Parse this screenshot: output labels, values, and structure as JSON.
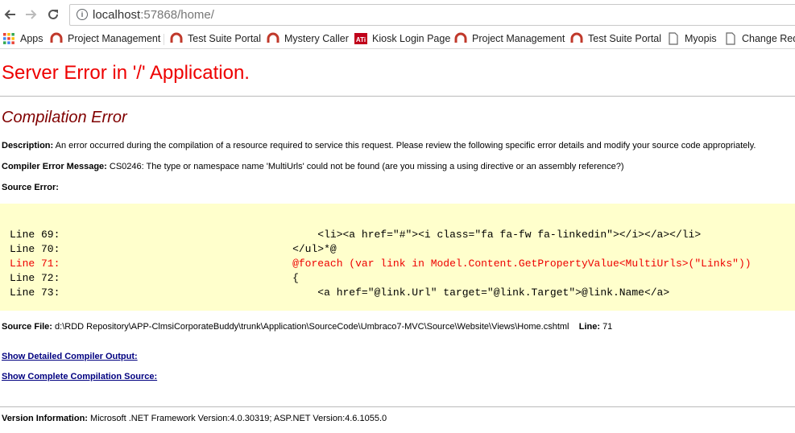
{
  "browser": {
    "url_host": "localhost",
    "url_rest": ":57868/home/"
  },
  "bookmarks": [
    {
      "label": "Apps",
      "icon": "apps-grid-icon"
    },
    {
      "label": "Project Management",
      "icon": "redirect-icon"
    },
    {
      "label": "Test Suite Portal",
      "icon": "redirect-icon"
    },
    {
      "label": "Mystery Caller",
      "icon": "redirect-icon"
    },
    {
      "label": "Kiosk Login Page",
      "icon": "ati-logo-icon"
    },
    {
      "label": "Project Management",
      "icon": "redirect-icon"
    },
    {
      "label": "Test Suite Portal",
      "icon": "redirect-icon"
    },
    {
      "label": "Myopis",
      "icon": "page-icon"
    },
    {
      "label": "Change Requ",
      "icon": "page-icon"
    }
  ],
  "error": {
    "title": "Server Error in '/' Application.",
    "subtitle": "Compilation Error",
    "description_label": "Description:",
    "description": "An error occurred during the compilation of a resource required to service this request. Please review the following specific error details and modify your source code appropriately.",
    "compiler_msg_label": "Compiler Error Message:",
    "compiler_msg": "CS0246: The type or namespace name 'MultiUrls' could not be found (are you missing a using directive or an assembly reference?)",
    "source_error_label": "Source Error:",
    "code_lines": [
      {
        "num": "Line 69:",
        "code": "                                        <li><a href=\"#\"><i class=\"fa fa-fw fa-linkedin\"></i></a></li>",
        "error": false
      },
      {
        "num": "Line 70:",
        "code": "                                    </ul>*@",
        "error": false
      },
      {
        "num": "Line 71:",
        "code": "                                    @foreach (var link in Model.Content.GetPropertyValue<MultiUrls>(\"Links\"))",
        "error": true
      },
      {
        "num": "Line 72:",
        "code": "                                    {",
        "error": false
      },
      {
        "num": "Line 73:",
        "code": "                                        <a href=\"@link.Url\" target=\"@link.Target\">@link.Name</a>",
        "error": false
      }
    ],
    "source_file_label": "Source File:",
    "source_file": "d:\\RDD Repository\\APP-ClmsiCorporateBuddy\\trunk\\Application\\SourceCode\\Umbraco7-MVC\\Source\\Website\\Views\\Home.cshtml",
    "line_label": "Line:",
    "line_value": "71",
    "show_output_link": "Show Detailed Compiler Output:",
    "show_source_link": "Show Complete Compilation Source:",
    "version_label": "Version Information:",
    "version": "Microsoft .NET Framework Version:4.0.30319; ASP.NET Version:4.6.1055.0"
  }
}
